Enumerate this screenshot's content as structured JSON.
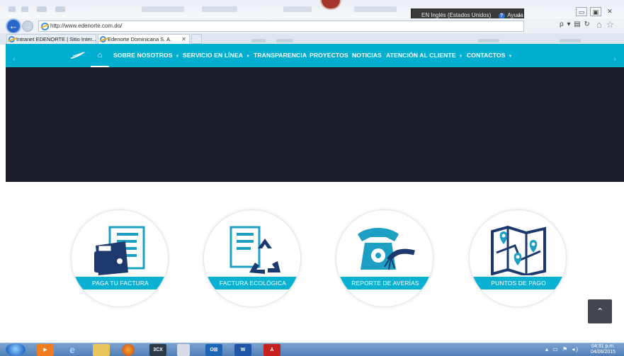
{
  "browser": {
    "url": "http://www.edenorte.com.do/",
    "language_bar": "EN Inglés (Estados Unidos)",
    "help_label": "Ayuda",
    "tabs": [
      {
        "label": "Intranet EDENORTE | Sitio Inter...",
        "active": false
      },
      {
        "label": "Edenorte Dominicana S. A.",
        "active": true
      }
    ],
    "search_glyph": "ρ",
    "window_buttons": [
      "▭",
      "▣",
      "✕"
    ]
  },
  "nav": {
    "items": [
      {
        "label": "SOBRE NOSOTROS",
        "dropdown": true
      },
      {
        "label": "SERVICIO EN LÍNEA",
        "dropdown": true
      },
      {
        "label": "TRANSPARENCIA",
        "dropdown": false
      },
      {
        "label": "PROYECTOS",
        "dropdown": false
      },
      {
        "label": "NOTICIAS",
        "dropdown": false
      },
      {
        "label": "ATENCIÓN AL CLIENTE",
        "dropdown": true
      },
      {
        "label": "CONTACTOS",
        "dropdown": true
      }
    ],
    "dropdown_glyph": "▼",
    "home_glyph": "⌂"
  },
  "services": [
    {
      "label": "PAGA TU FACTURA",
      "icon": "wallet-bill-icon"
    },
    {
      "label": "FACTURA ECOLÓGICA",
      "icon": "recycle-bill-icon"
    },
    {
      "label": "REPORTE DE AVERÍAS",
      "icon": "phone-cable-icon"
    },
    {
      "label": "PUNTOS DE PAGO",
      "icon": "map-pins-icon"
    }
  ],
  "back_to_top_glyph": "⌃",
  "taskbar": {
    "clock_time": "04:31 p.m.",
    "clock_date": "04/06/2015"
  },
  "colors": {
    "brand_cyan": "#00aed0",
    "hero_dark": "#1b1e2a",
    "icon_navy": "#1d3a6e"
  }
}
